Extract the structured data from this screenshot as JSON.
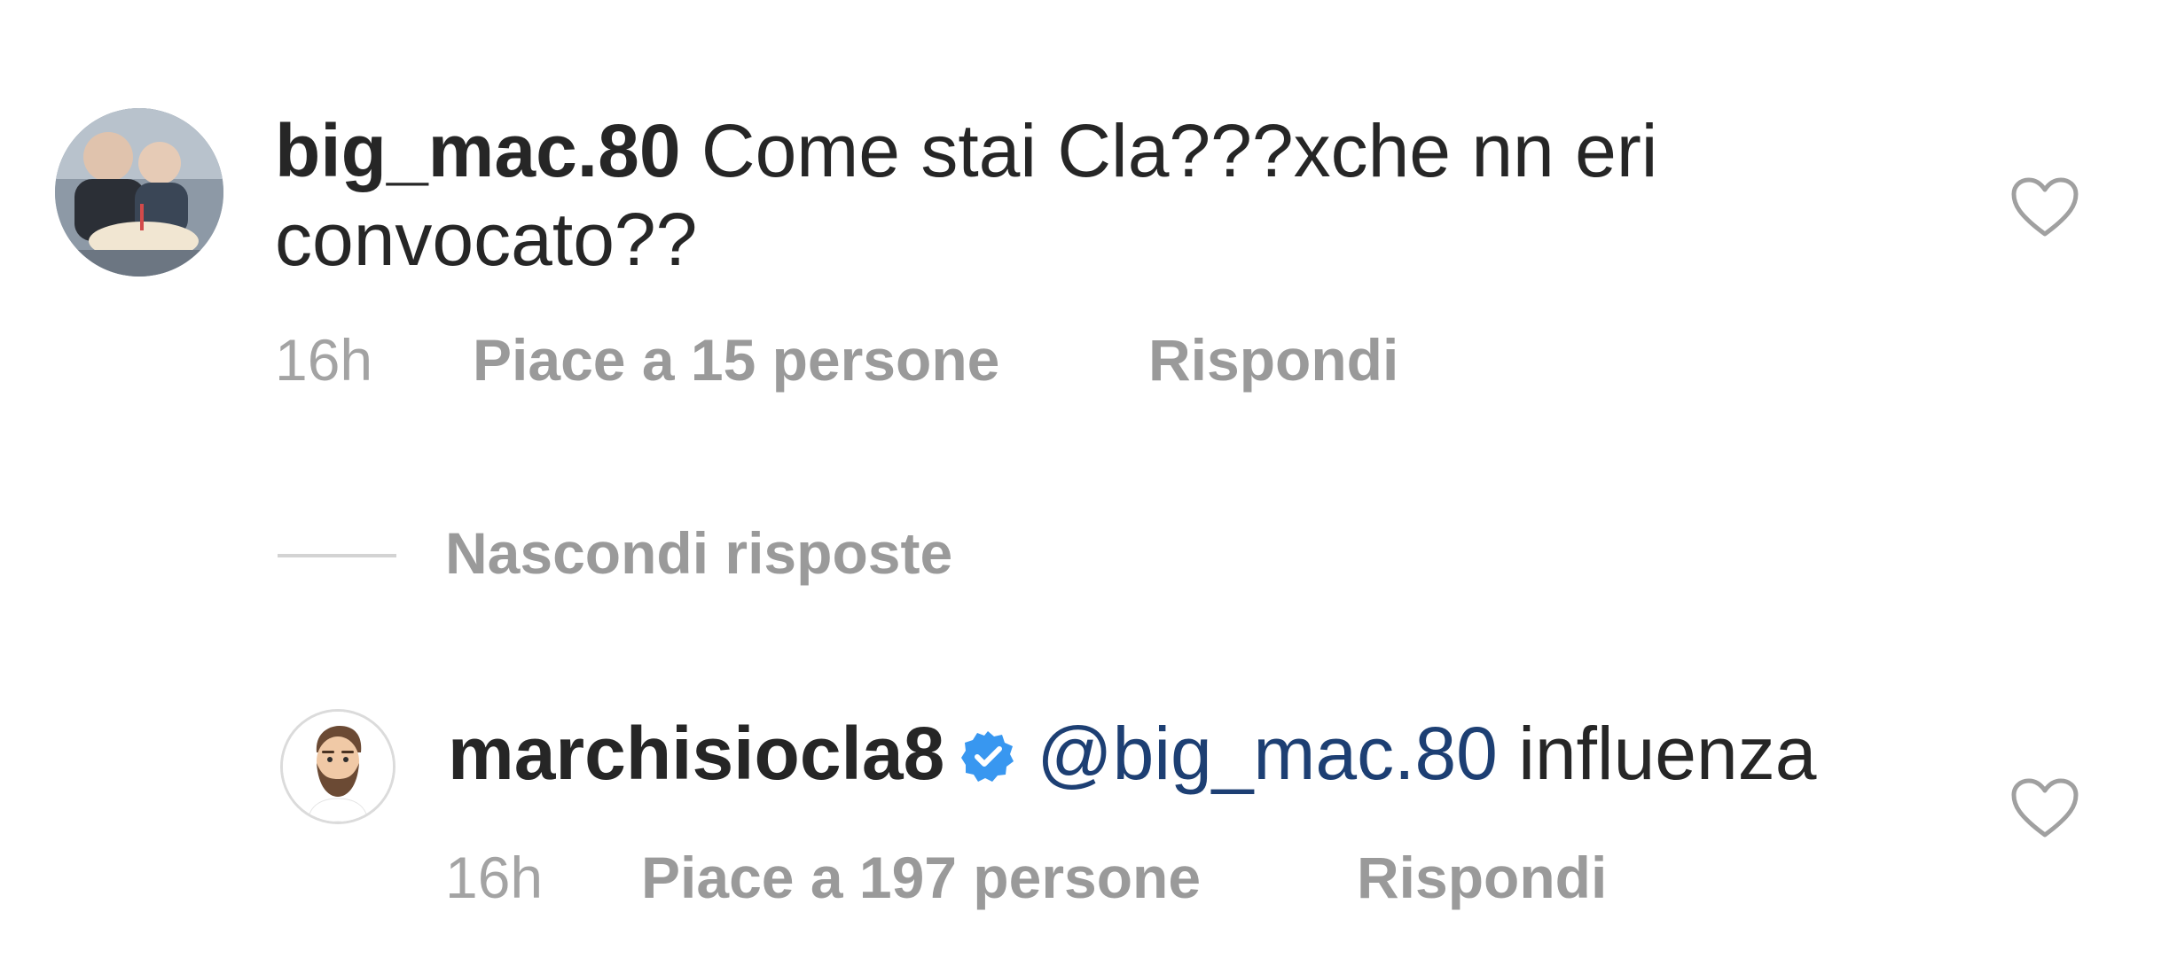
{
  "comments": [
    {
      "username": "big_mac.80",
      "text": " Come stai Cla???xche nn eri convocato??",
      "time": "16h",
      "likes": "Piace a 15 persone",
      "reply": "Rispondi"
    },
    {
      "username": "marchisiocla8",
      "verified": true,
      "mention": "@big_mac.80",
      "text": " influenza",
      "time": "16h",
      "likes": "Piace a 197 persone",
      "reply": "Rispondi"
    }
  ],
  "replies_toggle": "Nascondi risposte",
  "colors": {
    "text": "#262626",
    "meta": "#8e8e8e",
    "mention": "#1d3f73",
    "verified": "#3897f0",
    "divider": "#d3d3d3"
  },
  "icons": {
    "like": "heart-outline-icon",
    "verified": "verified-badge-icon"
  }
}
